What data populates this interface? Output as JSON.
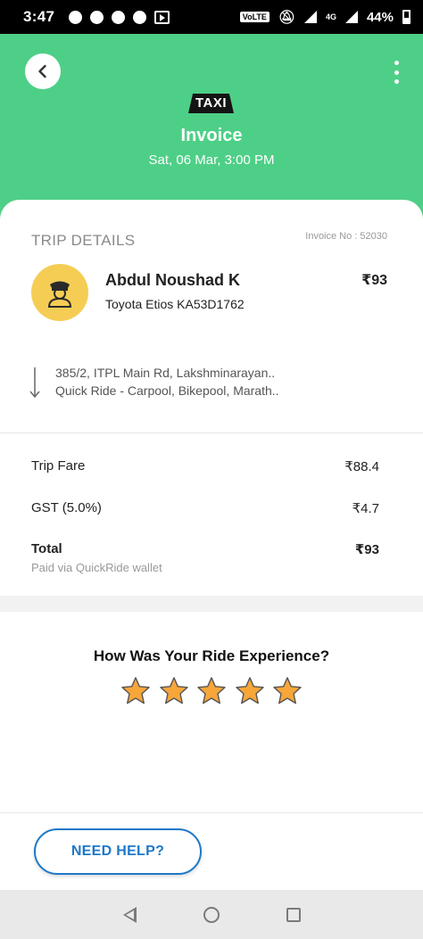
{
  "status_bar": {
    "time": "3:47",
    "network_label": "VoLTE",
    "network_type": "4G",
    "battery": "44%",
    "left_icons": [
      "chat-bubble-icon",
      "jio-icon",
      "jio-icon",
      "jio-icon",
      "video-icon"
    ]
  },
  "header": {
    "badge": "TAXI",
    "title": "Invoice",
    "date": "Sat, 06 Mar, 3:00 PM",
    "background_color": "#4ecf87"
  },
  "trip": {
    "section_label": "TRIP DETAILS",
    "invoice_no": "Invoice No : 52030",
    "driver_name": "Abdul Noushad K",
    "vehicle": "Toyota Etios KA53D1762",
    "amount": "₹93",
    "from": "385/2, ITPL Main Rd, Lakshminarayan..",
    "to": "Quick Ride - Carpool, Bikepool, Marath.."
  },
  "fare": {
    "rows": [
      {
        "label": "Trip Fare",
        "value": "₹88.4"
      },
      {
        "label": "GST (5.0%)",
        "value": "₹4.7"
      }
    ],
    "total_label": "Total",
    "total_value": "₹93",
    "paid_via": "Paid via QuickRide wallet"
  },
  "rating": {
    "question": "How Was Your Ride Experience?",
    "stars_total": 5,
    "stars_filled": 5,
    "star_color": "#f7a63a"
  },
  "help": {
    "button_label": "NEED HELP?",
    "accent_color": "#1e78c8"
  }
}
